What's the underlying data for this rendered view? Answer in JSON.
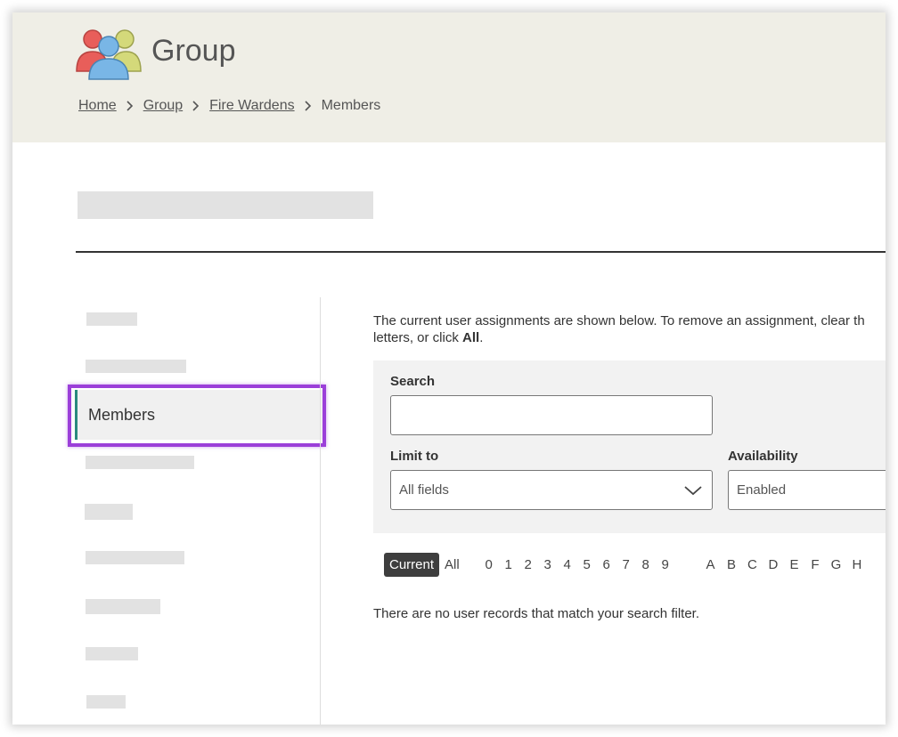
{
  "header": {
    "app_title": "Group",
    "logo_icon": "group-people-icon",
    "breadcrumb": {
      "home": "Home",
      "group": "Group",
      "fire_wardens": "Fire Wardens",
      "current": "Members"
    }
  },
  "sidebar": {
    "active_item": "Members"
  },
  "main": {
    "intro_text_1": "The current user assignments are shown below. To remove an assignment, clear th",
    "intro_text_2": "letters, or click ",
    "intro_bold": "All",
    "intro_text_3": ".",
    "filters": {
      "search_label": "Search",
      "search_value": "",
      "limit_label": "Limit to",
      "limit_value": "All fields",
      "availability_label": "Availability",
      "availability_value": "Enabled"
    },
    "letter_filter": {
      "current": "Current",
      "all": "All",
      "digits": [
        "0",
        "1",
        "2",
        "3",
        "4",
        "5",
        "6",
        "7",
        "8",
        "9"
      ],
      "letters": [
        "A",
        "B",
        "C",
        "D",
        "E",
        "F",
        "G",
        "H"
      ]
    },
    "empty_message": "There are no user records that match your search filter."
  },
  "colors": {
    "header_bg": "#efeee6",
    "highlight": "#9b3fd9",
    "active_accent": "#2a8a7e"
  }
}
